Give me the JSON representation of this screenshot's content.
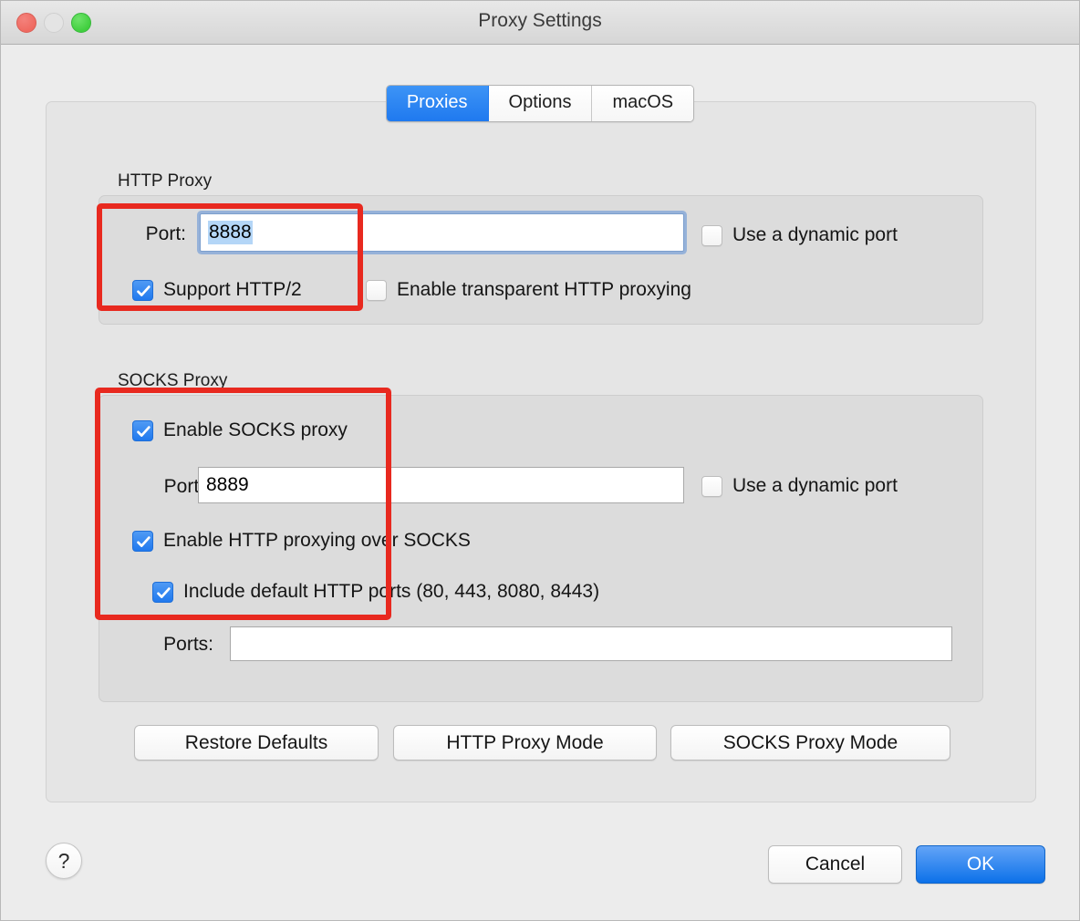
{
  "window": {
    "title": "Proxy Settings",
    "traffic_lights": [
      "close",
      "minimize",
      "zoom"
    ]
  },
  "tabs": [
    {
      "label": "Proxies",
      "active": true
    },
    {
      "label": "Options",
      "active": false
    },
    {
      "label": "macOS",
      "active": false
    }
  ],
  "http_proxy": {
    "group_label": "HTTP Proxy",
    "port_label": "Port:",
    "port_value": "8888",
    "port_focused": true,
    "port_selected": true,
    "dynamic_port": {
      "label": "Use a dynamic port",
      "checked": false
    },
    "support_http2": {
      "label": "Support HTTP/2",
      "checked": true
    },
    "transparent": {
      "label": "Enable transparent HTTP proxying",
      "checked": false
    }
  },
  "socks_proxy": {
    "group_label": "SOCKS Proxy",
    "enable": {
      "label": "Enable SOCKS proxy",
      "checked": true
    },
    "port_label": "Port:",
    "port_value": "8889",
    "dynamic_port": {
      "label": "Use a dynamic port",
      "checked": false
    },
    "http_over_socks": {
      "label": "Enable HTTP proxying over SOCKS",
      "checked": true
    },
    "include_default_ports": {
      "label": "Include default HTTP ports (80, 443, 8080, 8443)",
      "checked": true
    },
    "ports_label": "Ports:",
    "ports_value": ""
  },
  "mode_buttons": {
    "restore_defaults": "Restore Defaults",
    "http_proxy_mode": "HTTP Proxy Mode",
    "socks_proxy_mode": "SOCKS Proxy Mode"
  },
  "footer": {
    "help": "?",
    "cancel": "Cancel",
    "ok": "OK"
  },
  "annotations": [
    {
      "name": "http-port-and-http2-highlight"
    },
    {
      "name": "socks-options-highlight"
    }
  ],
  "colors": {
    "accent_blue": "#1f79ef",
    "checkbox_blue": "#2079ee",
    "selection_blue": "#b4d6f7",
    "annotation_red": "#e8291f",
    "window_bg": "#ececec",
    "panel_bg": "#e5e5e5",
    "group_bg": "#dcdcdc"
  }
}
